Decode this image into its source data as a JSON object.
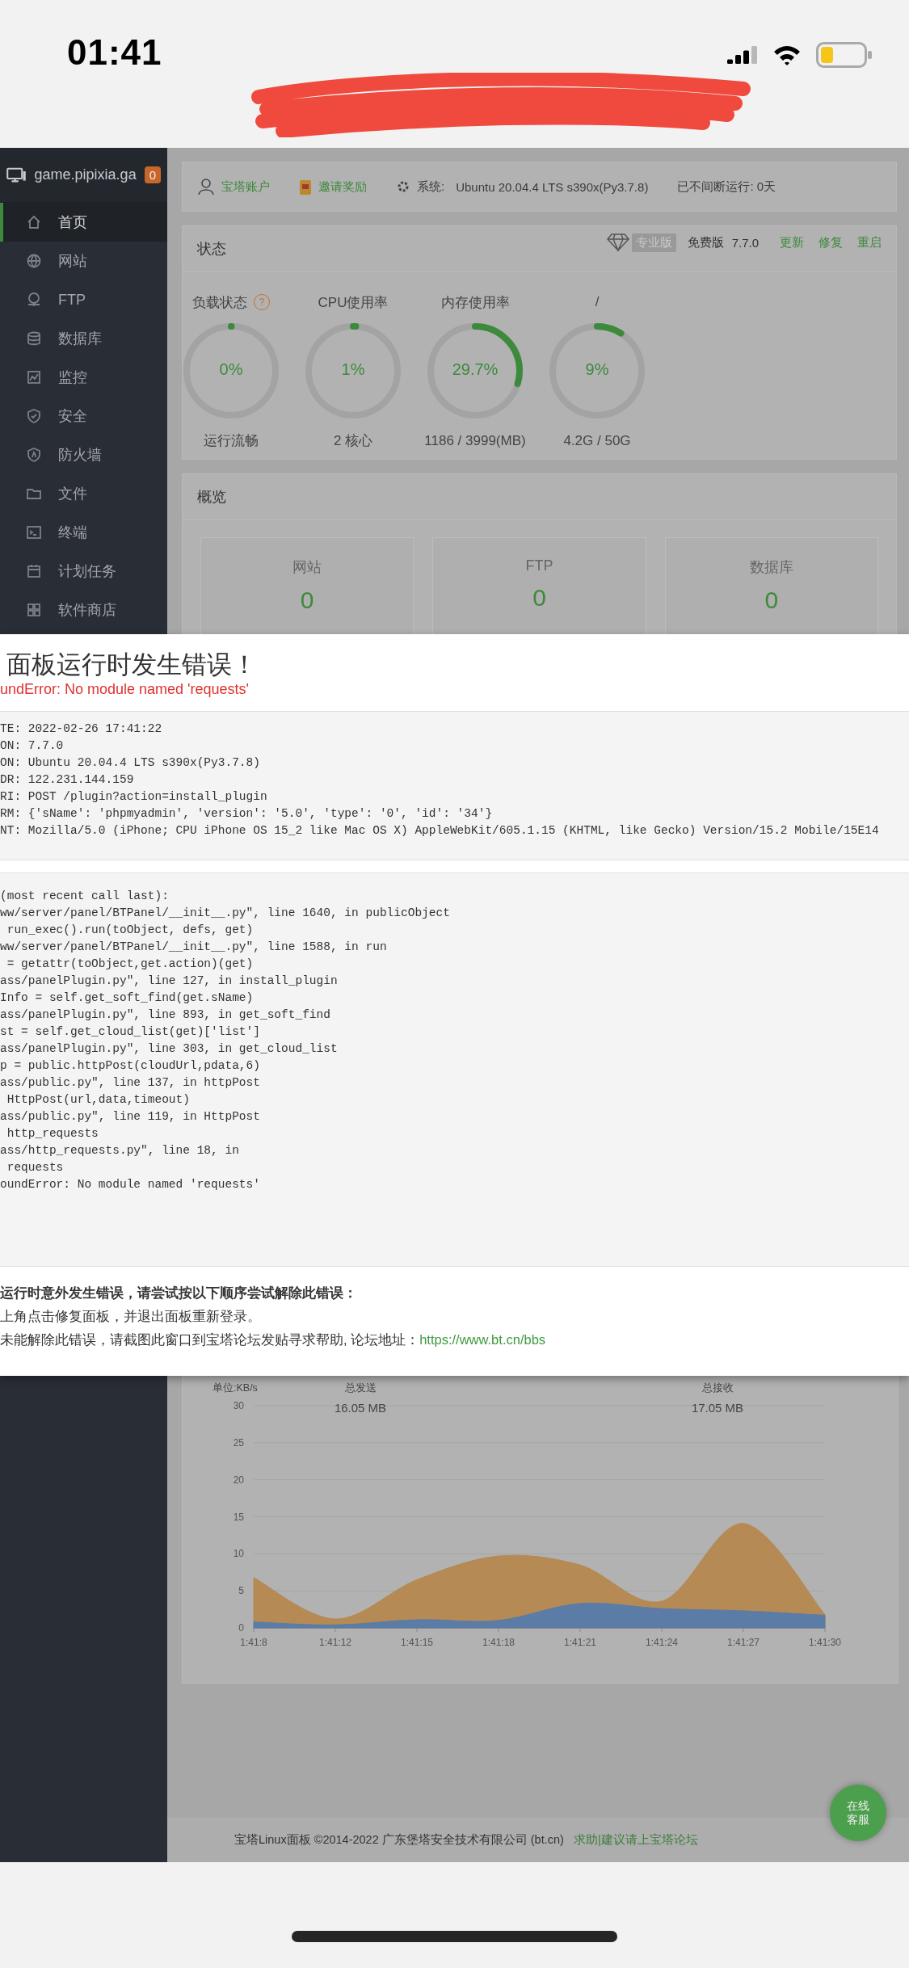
{
  "status_bar": {
    "time": "01:41"
  },
  "sidebar": {
    "host": "game.pipixia.ga",
    "badge": "0",
    "items": [
      {
        "label": "首页",
        "selected": true
      },
      {
        "label": "网站",
        "selected": false
      },
      {
        "label": "FTP",
        "selected": false
      },
      {
        "label": "数据库",
        "selected": false
      },
      {
        "label": "监控",
        "selected": false
      },
      {
        "label": "安全",
        "selected": false
      },
      {
        "label": "防火墙",
        "selected": false
      },
      {
        "label": "文件",
        "selected": false
      },
      {
        "label": "终端",
        "selected": false
      },
      {
        "label": "计划任务",
        "selected": false
      },
      {
        "label": "软件商店",
        "selected": false
      }
    ]
  },
  "top_bar": {
    "account": "宝塔账户",
    "invite": "邀请奖励",
    "system_label": "系统:",
    "system": "Ubuntu 20.04.4 LTS s390x(Py3.7.8)",
    "uptime": "已不间断运行: 0天"
  },
  "status_panel": {
    "title": "状态",
    "pro_badge": "专业版",
    "edition": "免费版",
    "version": "7.7.0",
    "actions": [
      "更新",
      "修复",
      "重启"
    ],
    "gauges": [
      {
        "title": "负载状态",
        "help": "?",
        "value": "0%",
        "level": 0,
        "caption": "运行流畅"
      },
      {
        "title": "CPU使用率",
        "value": "1%",
        "level": 0.01,
        "caption": "2 核心"
      },
      {
        "title": "内存使用率",
        "value": "29.7%",
        "level": 0.297,
        "caption": "1186 / 3999(MB)"
      },
      {
        "title": "/",
        "value": "9%",
        "level": 0.09,
        "caption": "4.2G / 50G"
      }
    ]
  },
  "overview": {
    "title": "概览",
    "cards": [
      {
        "label": "网站",
        "value": "0"
      },
      {
        "label": "FTP",
        "value": "0"
      },
      {
        "label": "数据库",
        "value": "0"
      }
    ]
  },
  "error_dialog": {
    "title": "面板运行时发生错误！",
    "error": "undError: No module named 'requests'",
    "request_info": [
      "TE: 2022-02-26 17:41:22",
      "ON: 7.7.0",
      "ON: Ubuntu 20.04.4 LTS s390x(Py3.7.8)",
      "DR: 122.231.144.159",
      "RI: POST /plugin?action=install_plugin",
      "RM: {'sName': 'phpmyadmin', 'version': '5.0', 'type': '0', 'id': '34'}",
      "NT: Mozilla/5.0 (iPhone; CPU iPhone OS 15_2 like Mac OS X) AppleWebKit/605.1.15 (KHTML, like Gecko) Version/15.2 Mobile/15E14"
    ],
    "traceback": [
      "(most recent call last):",
      "ww/server/panel/BTPanel/__init__.py\", line 1640, in publicObject",
      " run_exec().run(toObject, defs, get)",
      "ww/server/panel/BTPanel/__init__.py\", line 1588, in run",
      " = getattr(toObject,get.action)(get)",
      "ass/panelPlugin.py\", line 127, in install_plugin",
      "Info = self.get_soft_find(get.sName)",
      "ass/panelPlugin.py\", line 893, in get_soft_find",
      "st = self.get_cloud_list(get)['list']",
      "ass/panelPlugin.py\", line 303, in get_cloud_list",
      "p = public.httpPost(cloudUrl,pdata,6)",
      "ass/public.py\", line 137, in httpPost",
      " HttpPost(url,data,timeout)",
      "ass/public.py\", line 119, in HttpPost",
      " http_requests",
      "ass/http_requests.py\", line 18, in",
      " requests",
      "oundError: No module named 'requests'"
    ],
    "help_title": "运行时意外发生错误，请尝试按以下顺序尝试解除此错误：",
    "help_steps": [
      {
        "text": "上角点击修复面板，并退出面板重新登录。"
      },
      {
        "text": "未能解除此错误，请截图此窗口到宝塔论坛发贴寻求帮助, 论坛地址：",
        "link": "https://www.bt.cn/bbs"
      }
    ]
  },
  "traffic": {
    "unit": "单位:KB/s",
    "sent_label": "总发送",
    "sent": "16.05 MB",
    "received_label": "总接收",
    "received": "17.05 MB",
    "chart_data": {
      "type": "area",
      "categories": [
        "1:41:8",
        "1:41:12",
        "1:41:15",
        "1:41:18",
        "1:41:21",
        "1:41:24",
        "1:41:27",
        "1:41:30"
      ],
      "ylim": [
        0,
        30
      ],
      "grid": true,
      "yticks": [
        0,
        5,
        10,
        15,
        20,
        25,
        30
      ],
      "series": [
        {
          "color": "#b58a55",
          "values": [
            6.8,
            1.2,
            6.5,
            9.7,
            8.5,
            3.6,
            14.1,
            1.8
          ]
        },
        {
          "color": "#5a7ca6",
          "values": [
            0.8,
            0.4,
            1.1,
            1.0,
            3.3,
            2.6,
            2.3,
            1.7
          ]
        }
      ]
    }
  },
  "footer": {
    "copyright": "宝塔Linux面板 ©2014-2022 广东堡塔安全技术有限公司 (bt.cn)",
    "link": "求助|建议请上宝塔论坛"
  },
  "support_button": {
    "lines": [
      "在线",
      "客服"
    ]
  }
}
